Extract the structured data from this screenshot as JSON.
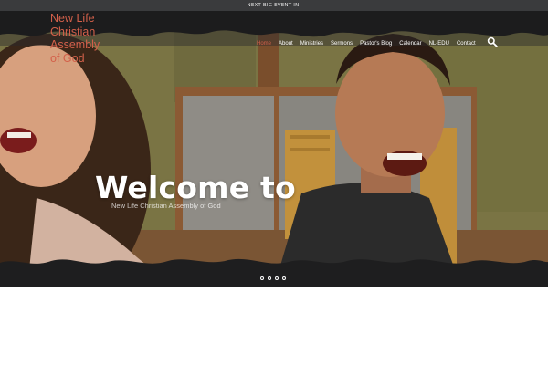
{
  "topbar": {
    "text": "NEXT BIG EVENT IN:"
  },
  "logo": {
    "lines": [
      "New Life",
      "Christian",
      "Assembly",
      "of God"
    ]
  },
  "nav": {
    "items": [
      {
        "label": "Home",
        "active": true
      },
      {
        "label": "About",
        "active": false
      },
      {
        "label": "Ministries",
        "active": false
      },
      {
        "label": "Sermons",
        "active": false
      },
      {
        "label": "Pastor's Blog",
        "active": false
      },
      {
        "label": "Calendar",
        "active": false
      },
      {
        "label": "NL-EDU",
        "active": false
      },
      {
        "label": "Contact",
        "active": false
      }
    ],
    "search_icon": "search-icon"
  },
  "hero": {
    "title": "Welcome to",
    "subtitle": "New Life Christian Assembly of God"
  },
  "slider": {
    "slide_count": 4,
    "active_index": 0
  },
  "colors": {
    "accent": "#d3604a",
    "topbar": "#3a3b3d",
    "grunge": "#1c1c1d"
  }
}
